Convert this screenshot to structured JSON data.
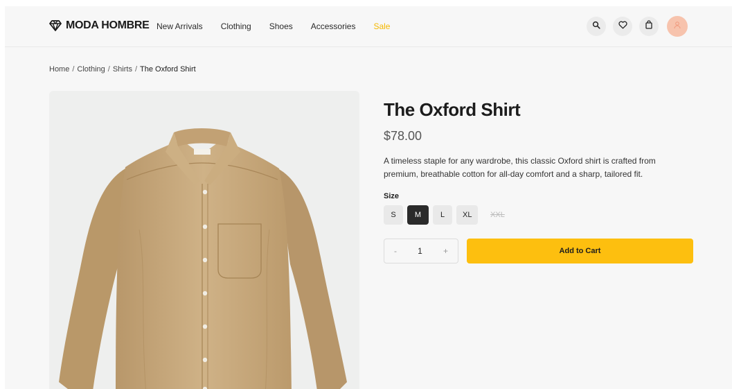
{
  "brand": {
    "name": "MODA HOMBRE",
    "icon": "diamond-icon"
  },
  "nav": {
    "items": [
      {
        "label": "New Arrivals"
      },
      {
        "label": "Clothing"
      },
      {
        "label": "Shoes"
      },
      {
        "label": "Accessories"
      },
      {
        "label": "Sale",
        "color": "#f5b800"
      }
    ]
  },
  "header_icons": [
    "search-icon",
    "heart-icon",
    "bag-icon",
    "user-avatar"
  ],
  "breadcrumb": {
    "items": [
      "Home",
      "Clothing",
      "Shirts",
      "The Oxford Shirt"
    ],
    "separator": "/"
  },
  "product": {
    "title": "The Oxford Shirt",
    "price": "$78.00",
    "description": "A timeless staple for any wardrobe, this classic Oxford shirt is crafted from premium, breathable cotton for all-day comfort and a sharp, tailored fit.",
    "size_label": "Size",
    "sizes": [
      {
        "label": "S",
        "state": "available"
      },
      {
        "label": "M",
        "state": "selected"
      },
      {
        "label": "L",
        "state": "available"
      },
      {
        "label": "XL",
        "state": "available"
      },
      {
        "label": "XXL",
        "state": "unavailable"
      }
    ],
    "quantity": {
      "minus": "-",
      "value": "1",
      "plus": "+"
    },
    "add_to_cart": "Add to Cart",
    "image_alt": "Tan oxford button-down shirt"
  },
  "colors": {
    "accent": "#fdbf0f",
    "sale": "#f5b800",
    "selected_size": "#2b2b2b",
    "shirt": "#c7a878"
  }
}
